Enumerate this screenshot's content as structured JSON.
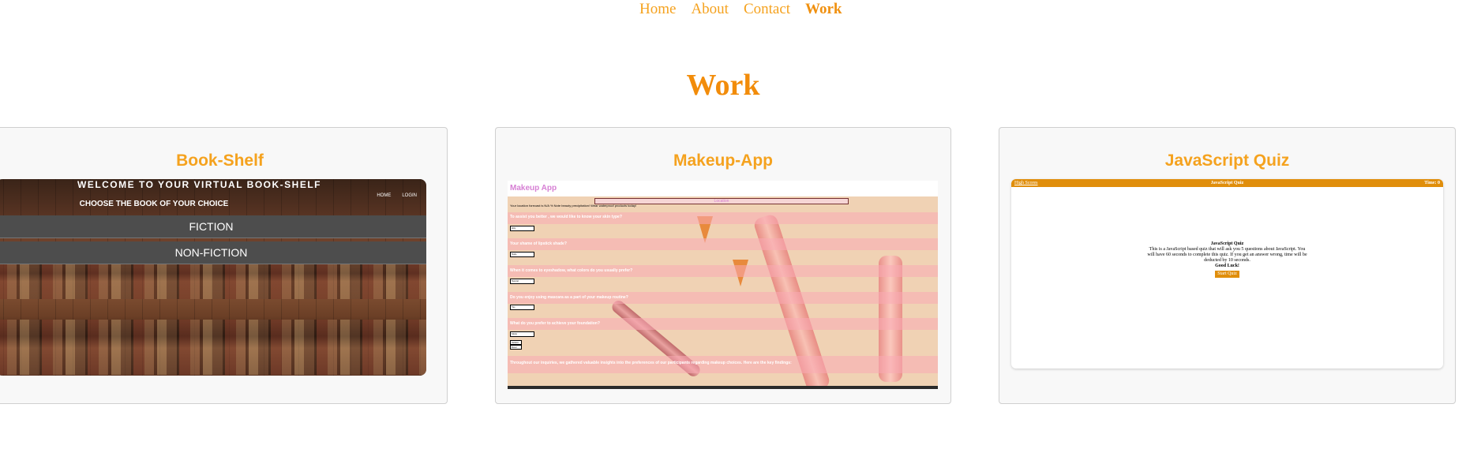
{
  "nav": {
    "items": [
      "Home",
      "About",
      "Contact",
      "Work"
    ],
    "active": "Work"
  },
  "page_title": "Work",
  "projects": [
    {
      "title": "Book-Shelf",
      "preview": {
        "heading": "WELCOME TO YOUR VIRTUAL BOOK-SHELF",
        "nav": [
          "HOME",
          "LOGIN"
        ],
        "subheading": "CHOOSE THE BOOK OF YOUR CHOICE",
        "buttons": [
          "FICTION",
          "NON-FICTION"
        ]
      }
    },
    {
      "title": "Makeup-App",
      "preview": {
        "app_name": "Makeup App",
        "location_label": "Location",
        "location_text": "Your location forecast is N/A % Note beauty precipitation! Wear waterproof products today!",
        "questions": [
          "To assist you better , we would like to know your skin type?",
          "Your shame of lipstick shade?",
          "When it comes to eyeshadow, what colors do you usually prefer?",
          "Do you enjoy using mascara as a part of your makeup routine?",
          "What do you prefer to achieve your foundation?"
        ],
        "select_values": [
          "Oily",
          "Nude",
          "Neutral",
          "Yes",
          "Matte"
        ],
        "actions": [
          "Submit",
          "Reset"
        ],
        "insights": "Throughout our inquiries, we gathered valuable insights into the preferences of our participants regarding makeup choices. Here are the key findings:"
      }
    },
    {
      "title": "JavaScript Quiz",
      "preview": {
        "high_scores": "High Scores",
        "bar_title": "JavaScript Quiz",
        "time": "Time: 0",
        "heading": "JavaScript Quiz",
        "description": "This is a JavaScript based quiz that will ask you 5 questions about JavaScript. You will have 60 seconds to complete this quiz. If you get an answer wrong, time will be deducted by 10 seconds.",
        "good_luck": "Good Luck!",
        "start_button": "Start Quiz"
      }
    }
  ],
  "colors": {
    "accent": "#f5a21e",
    "title": "#f28c0a",
    "quiz_bar": "#e08e0b"
  }
}
